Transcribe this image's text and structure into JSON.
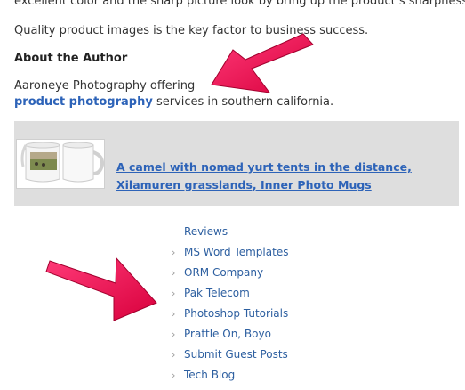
{
  "article": {
    "line1": "excellent color and the sharp picture look by bring up the product’s sharpness.",
    "line2": "Quality product images is the key factor to business success."
  },
  "author": {
    "heading": "About the Author",
    "text1": "Aaroneye Photography offering",
    "link": "product photography",
    "text2": " services in southern california."
  },
  "product": {
    "title": "A camel with nomad yurt tents in the distance, Xilamuren grasslands, Inner Photo Mugs"
  },
  "nav": {
    "items": [
      {
        "label": "Reviews"
      },
      {
        "label": "MS Word Templates"
      },
      {
        "label": "ORM Company"
      },
      {
        "label": "Pak Telecom"
      },
      {
        "label": "Photoshop Tutorials"
      },
      {
        "label": "Prattle On, Boyo"
      },
      {
        "label": "Submit Guest Posts"
      },
      {
        "label": "Tech Blog"
      }
    ]
  },
  "colors": {
    "link": "#2d63b8",
    "arrow": "#ee1155",
    "box": "#dedede"
  }
}
